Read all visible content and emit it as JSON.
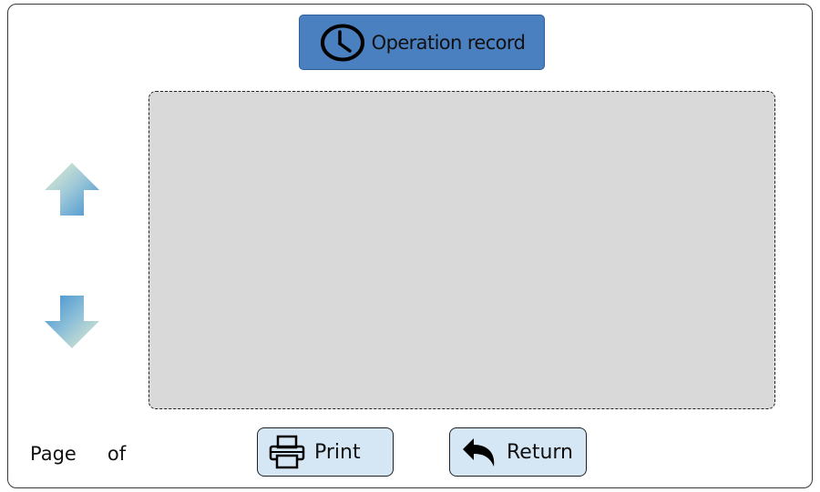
{
  "header": {
    "title": "Operation record",
    "icon": "clock-icon"
  },
  "navigation": {
    "up_icon": "arrow-up-icon",
    "down_icon": "arrow-down-icon"
  },
  "footer": {
    "page_label": "Page",
    "of_label": "of",
    "print_label": "Print",
    "print_icon": "printer-icon",
    "return_label": "Return",
    "return_icon": "undo-arrow-icon"
  },
  "colors": {
    "title_button_bg": "#4a7fc0",
    "action_button_bg": "#d5e6f4",
    "display_area_bg": "#d9d9d9",
    "arrow_gradient_start": "#e6efcf",
    "arrow_gradient_end": "#3f8fd0"
  }
}
